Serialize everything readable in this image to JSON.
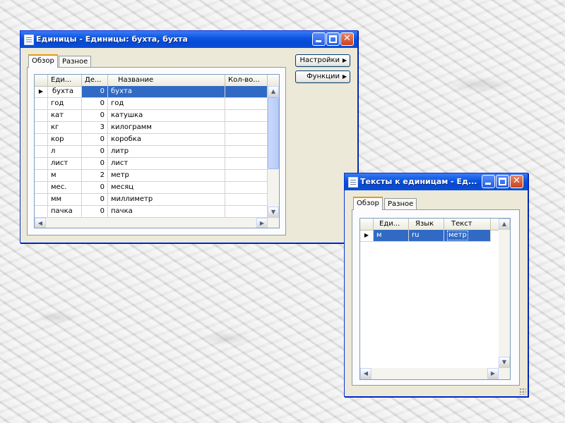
{
  "window1": {
    "title": "Единицы - Единицы: бухта, бухта",
    "tabs": [
      {
        "label": "Обзор"
      },
      {
        "label": "Разное"
      }
    ],
    "buttons": {
      "settings": "Настройки",
      "functions": "Функции"
    },
    "table": {
      "columns": [
        "Еди...",
        "Де...",
        "Название",
        "Кол-во..."
      ],
      "rows": [
        {
          "unit": "бухта",
          "dec": "0",
          "name": "бухта",
          "qty": ""
        },
        {
          "unit": "год",
          "dec": "0",
          "name": "год",
          "qty": ""
        },
        {
          "unit": "кат",
          "dec": "0",
          "name": "катушка",
          "qty": ""
        },
        {
          "unit": "кг",
          "dec": "3",
          "name": "килограмм",
          "qty": ""
        },
        {
          "unit": "кор",
          "dec": "0",
          "name": "коробка",
          "qty": ""
        },
        {
          "unit": "л",
          "dec": "0",
          "name": "литр",
          "qty": ""
        },
        {
          "unit": "лист",
          "dec": "0",
          "name": "лист",
          "qty": ""
        },
        {
          "unit": "м",
          "dec": "2",
          "name": "метр",
          "qty": ""
        },
        {
          "unit": "мес.",
          "dec": "0",
          "name": "месяц",
          "qty": ""
        },
        {
          "unit": "мм",
          "dec": "0",
          "name": "миллиметр",
          "qty": ""
        },
        {
          "unit": "пачка",
          "dec": "0",
          "name": "пачка",
          "qty": ""
        }
      ]
    }
  },
  "window2": {
    "title": "Тексты к единицам - Ед...",
    "tabs": [
      {
        "label": "Обзор"
      },
      {
        "label": "Разное"
      }
    ],
    "table": {
      "columns": [
        "Еди...",
        "Язык",
        "Текст"
      ],
      "rows": [
        {
          "unit": "м",
          "lang": "ru",
          "text": "метр"
        }
      ]
    }
  },
  "icons": {
    "row_indicator": "▶",
    "scroll_up": "▲",
    "scroll_down": "▼",
    "scroll_left": "◀",
    "scroll_right": "▶",
    "menu_arrow": "▶",
    "minimize": "minimize-icon",
    "maximize": "maximize-icon",
    "close": "✕"
  },
  "colors": {
    "title_bar": "#0a53e0",
    "selection": "#316ac5",
    "window_bg": "#ece9d8",
    "close_button": "#c8431c",
    "active_tab_accent": "#e69a12"
  }
}
